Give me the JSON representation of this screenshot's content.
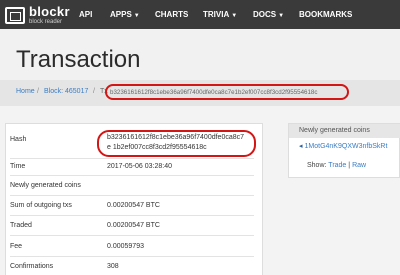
{
  "nav": {
    "brand": "blockr",
    "brand_sub": "block reader",
    "items": [
      {
        "label": "API",
        "caret": ""
      },
      {
        "label": "APPS",
        "caret": "▼"
      },
      {
        "label": "CHARTS",
        "caret": ""
      },
      {
        "label": "TRIVIA",
        "caret": "▼"
      },
      {
        "label": "DOCS",
        "caret": "▼"
      },
      {
        "label": "BOOKMARKS",
        "caret": ""
      }
    ]
  },
  "page": {
    "title": "Transaction"
  },
  "breadcrumb": {
    "home": "Home",
    "sep": "/",
    "block": "Block: 465017",
    "tx_prefix": "Tx",
    "tx": "b3236161612f8c1ebe36a96f7400dfe0ca8c7e1b2ef007cc8f3cd2f95554618c"
  },
  "details": {
    "hash_label": "Hash",
    "hash_value": "b3236161612f8c1ebe36a96f7400dfe0ca8c7e 1b2ef007cc8f3cd2f95554618c",
    "time_label": "Time",
    "time_value": "2017-05-06 03:28:40",
    "newly_generated_label": "Newly generated coins",
    "sum_outgoing_label": "Sum of outgoing txs",
    "sum_outgoing_value": "0.00200547 BTC",
    "traded_label": "Traded",
    "traded_value": "0.00200547 BTC",
    "fee_label": "Fee",
    "fee_value": "0.00059793",
    "confirmations_label": "Confirmations",
    "confirmations_value": "308"
  },
  "side": {
    "header": "Newly generated coins",
    "address": "1MotG4nK9QXW3nfbSkRt",
    "show_label": "Show:",
    "trade_link": "Trade",
    "pipe": "|",
    "raw_link": "Raw"
  },
  "colors": {
    "navbar": "#3a3a3a",
    "link": "#3b7dc4",
    "highlight": "#d31515"
  }
}
